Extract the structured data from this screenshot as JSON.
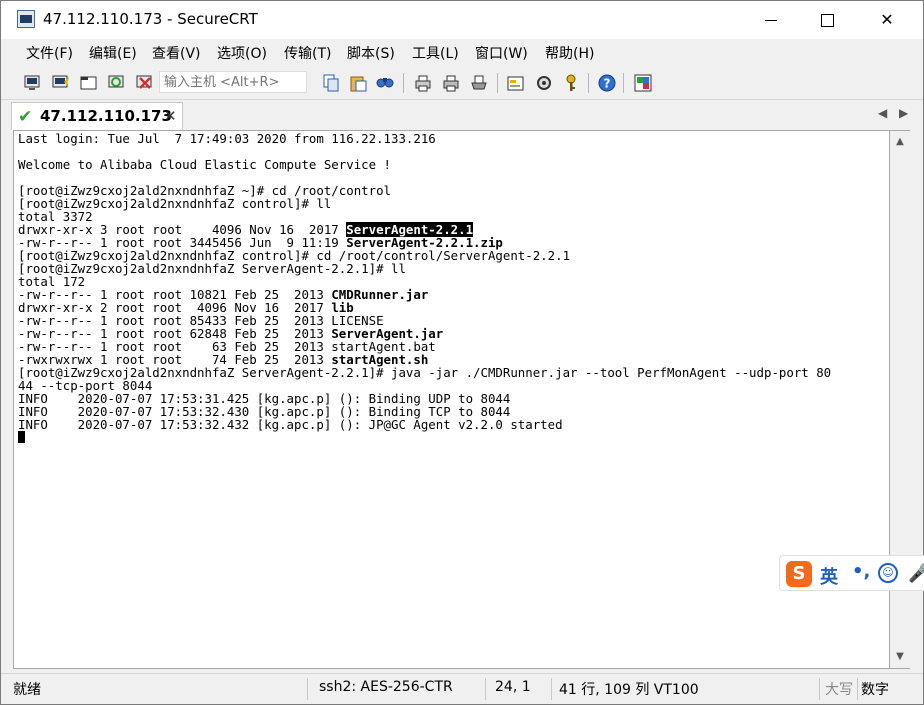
{
  "window": {
    "title": "47.112.110.173 - SecureCRT",
    "minimize_glyph": "",
    "close_glyph": "✕"
  },
  "menu": [
    {
      "label": "文件(F)"
    },
    {
      "label": "编辑(E)"
    },
    {
      "label": "查看(V)"
    },
    {
      "label": "选项(O)"
    },
    {
      "label": "传输(T)"
    },
    {
      "label": "脚本(S)"
    },
    {
      "label": "工具(L)"
    },
    {
      "label": "窗口(W)"
    },
    {
      "label": "帮助(H)"
    }
  ],
  "toolbar": {
    "host_placeholder": "输入主机 <Alt+R>",
    "icons": [
      "connect-icon",
      "quick-connect-icon",
      "connect-tab-icon",
      "reconnect-icon",
      "disconnect-icon",
      "copy-icon",
      "paste-icon",
      "find-icon",
      "print-setup-icon",
      "print-icon",
      "print-preview-icon",
      "session-options-icon",
      "global-options-icon",
      "key-icon",
      "help-icon",
      "sftp-icon"
    ]
  },
  "tab": {
    "label": "47.112.110.173",
    "close_glyph": "✕",
    "status_color": "#2e9d32"
  },
  "terminal": {
    "lines": [
      [
        {
          "t": "Last login: Tue Jul  7 17:49:03 2020 from 116.22.133.216"
        }
      ],
      [
        {
          "t": ""
        }
      ],
      [
        {
          "t": "Welcome to Alibaba Cloud Elastic Compute Service !"
        }
      ],
      [
        {
          "t": ""
        }
      ],
      [
        {
          "t": "[root@iZwz9cxoj2ald2nxndnhfaZ ~]# cd /root/control"
        }
      ],
      [
        {
          "t": "[root@iZwz9cxoj2ald2nxndnhfaZ control]# ll"
        }
      ],
      [
        {
          "t": "total 3372"
        }
      ],
      [
        {
          "t": "drwxr-xr-x 3 root root    4096 Nov 16  2017 "
        },
        {
          "t": "ServerAgent-2.2.1",
          "s": "inv"
        }
      ],
      [
        {
          "t": "-rw-r--r-- 1 root root 3445456 Jun  9 11:19 "
        },
        {
          "t": "ServerAgent-2.2.1.zip",
          "s": "bold"
        }
      ],
      [
        {
          "t": "[root@iZwz9cxoj2ald2nxndnhfaZ control]# cd /root/control/ServerAgent-2.2.1"
        }
      ],
      [
        {
          "t": "[root@iZwz9cxoj2ald2nxndnhfaZ ServerAgent-2.2.1]# ll"
        }
      ],
      [
        {
          "t": "total 172"
        }
      ],
      [
        {
          "t": "-rw-r--r-- 1 root root 10821 Feb 25  2013 "
        },
        {
          "t": "CMDRunner.jar",
          "s": "bold"
        }
      ],
      [
        {
          "t": "drwxr-xr-x 2 root root  4096 Nov 16  2017 "
        },
        {
          "t": "lib",
          "s": "bold"
        }
      ],
      [
        {
          "t": "-rw-r--r-- 1 root root 85433 Feb 25  2013 LICENSE"
        }
      ],
      [
        {
          "t": "-rw-r--r-- 1 root root 62848 Feb 25  2013 "
        },
        {
          "t": "ServerAgent.jar",
          "s": "bold"
        }
      ],
      [
        {
          "t": "-rw-r--r-- 1 root root    63 Feb 25  2013 startAgent.bat"
        }
      ],
      [
        {
          "t": "-rwxrwxrwx 1 root root    74 Feb 25  2013 "
        },
        {
          "t": "startAgent.sh",
          "s": "bold"
        }
      ],
      [
        {
          "t": "[root@iZwz9cxoj2ald2nxndnhfaZ ServerAgent-2.2.1]# java -jar ./CMDRunner.jar --tool PerfMonAgent --udp-port 80"
        }
      ],
      [
        {
          "t": "44 --tcp-port 8044"
        }
      ],
      [
        {
          "t": "INFO    2020-07-07 17:53:31.425 [kg.apc.p] (): Binding UDP to 8044"
        }
      ],
      [
        {
          "t": "INFO    2020-07-07 17:53:32.430 [kg.apc.p] (): Binding TCP to 8044"
        }
      ],
      [
        {
          "t": "INFO    2020-07-07 17:53:32.432 [kg.apc.p] (): JP@GC Agent v2.2.0 started"
        }
      ]
    ]
  },
  "ime": {
    "logo": "S",
    "lang": "英",
    "punct": "•,",
    "emoji": "☺",
    "mic": "🎤"
  },
  "status": {
    "ready": "就绪",
    "protocol": "ssh2: AES-256-CTR",
    "cursor_pos": "24,   1",
    "size": "41 行, 109 列 VT100",
    "caps": "大写",
    "num": "数字"
  }
}
